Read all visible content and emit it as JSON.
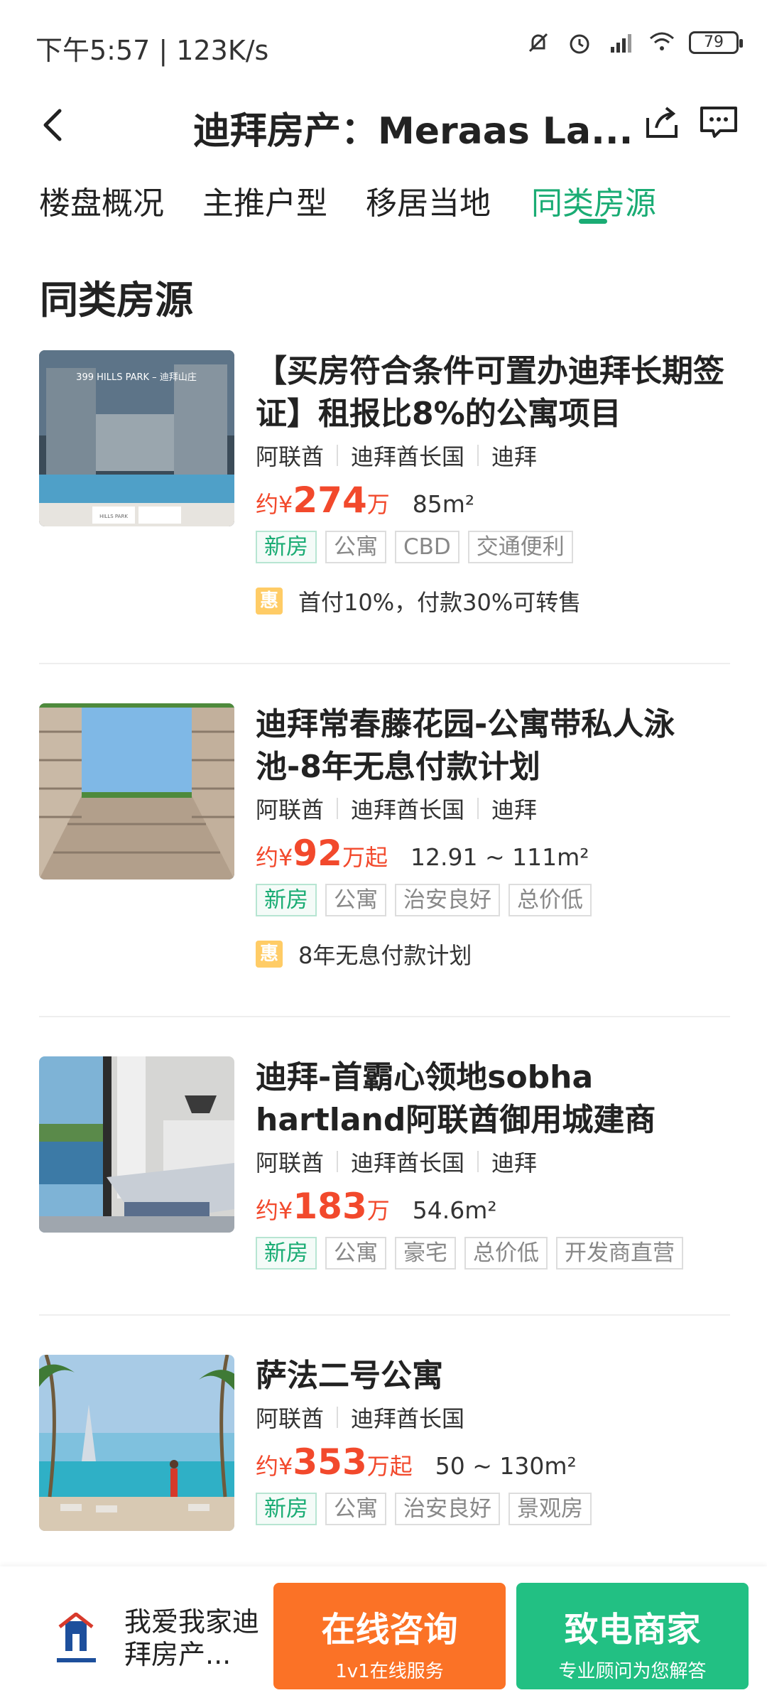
{
  "status_bar": {
    "time_speed": "下午5:57 | 123K/s",
    "battery": "79"
  },
  "header": {
    "title": "迪拜房产：Meraas La..."
  },
  "tabs": [
    "楼盘概况",
    "主推户型",
    "移居当地",
    "同类房源"
  ],
  "active_tab": "同类房源",
  "section_title": "同类房源",
  "listings": [
    {
      "title": "【买房符合条件可置办迪拜长期签证】租报比8%的公寓项目",
      "location": [
        "阿联酋",
        "迪拜酋长国",
        "迪拜"
      ],
      "price_prefix": "约¥",
      "price": "274",
      "price_unit": "万",
      "area": "85m²",
      "tags": [
        "新房",
        "公寓",
        "CBD",
        "交通便利"
      ],
      "promo_badge": "惠",
      "promo": "首付10%，付款30%可转售",
      "image_text": [
        "399 HILLS PARK – 迪拜山庄",
        "HILLS PARK"
      ]
    },
    {
      "title": "迪拜常春藤花园-公寓带私人泳池-8年无息付款计划",
      "location": [
        "阿联酋",
        "迪拜酋长国",
        "迪拜"
      ],
      "price_prefix": "约¥",
      "price": "92",
      "price_unit": "万起",
      "area": "12.91 ~ 111m²",
      "tags": [
        "新房",
        "公寓",
        "治安良好",
        "总价低"
      ],
      "promo_badge": "惠",
      "promo": "8年无息付款计划"
    },
    {
      "title": "迪拜-首霸心领地sobha hartland阿联酋御用城建商",
      "location": [
        "阿联酋",
        "迪拜酋长国",
        "迪拜"
      ],
      "price_prefix": "约¥",
      "price": "183",
      "price_unit": "万",
      "area": "54.6m²",
      "tags": [
        "新房",
        "公寓",
        "豪宅",
        "总价低",
        "开发商直营"
      ]
    },
    {
      "title": "萨法二号公寓",
      "location": [
        "阿联酋",
        "迪拜酋长国"
      ],
      "price_prefix": "约¥",
      "price": "353",
      "price_unit": "万起",
      "area": "50 ~ 130m²",
      "tags": [
        "新房",
        "公寓",
        "治安良好",
        "景观房"
      ]
    }
  ],
  "bottom_bar": {
    "agent_name": "我爱我家迪拜房产...",
    "consult_label": "在线咨询",
    "consult_sub": "1v1在线服务",
    "call_label": "致电商家",
    "call_sub": "专业顾问为您解答"
  },
  "colors": {
    "accent_green": "#1aac74",
    "price_red": "#f2492c",
    "orange_button": "#fb7226",
    "green_button": "#22c083"
  }
}
